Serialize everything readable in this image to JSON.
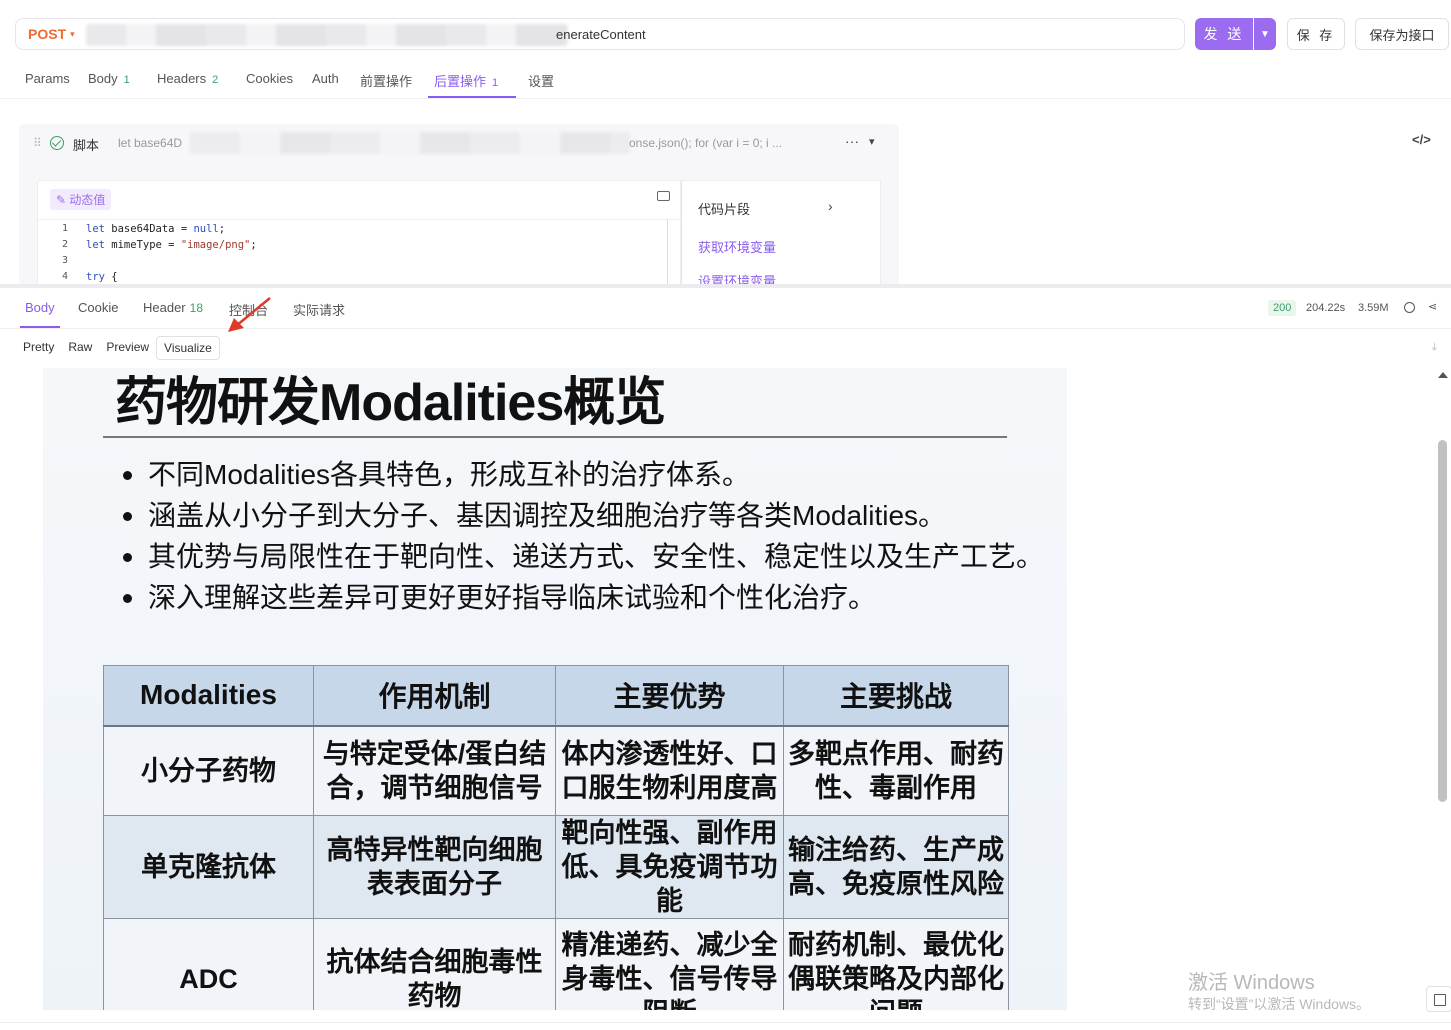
{
  "request": {
    "method": "POST",
    "url_visible": "enerateContent",
    "send_label": "发 送",
    "save_label": "保 存",
    "save_api_label": "保存为接口"
  },
  "req_tabs": [
    {
      "label": "Params",
      "count": ""
    },
    {
      "label": "Body",
      "count": "1"
    },
    {
      "label": "Headers",
      "count": "2"
    },
    {
      "label": "Cookies",
      "count": ""
    },
    {
      "label": "Auth",
      "count": ""
    },
    {
      "label": "前置操作",
      "count": ""
    },
    {
      "label": "后置操作",
      "count": "1",
      "active": true
    },
    {
      "label": "设置",
      "count": ""
    }
  ],
  "script": {
    "title": "脚本",
    "preview_start": "let base64D",
    "preview_end": "onse.json(); for (var i = 0; i ...",
    "dynamic_value": "动态值",
    "lines": [
      {
        "n": "1",
        "text": "let base64Data = null;"
      },
      {
        "n": "2",
        "text": "let mimeType = \"image/png\";"
      },
      {
        "n": "3",
        "text": ""
      },
      {
        "n": "4",
        "text": "try {"
      }
    ],
    "snippets_title": "代码片段",
    "snippets": [
      "获取环境变量",
      "设置环境变量"
    ]
  },
  "response": {
    "tabs": [
      {
        "label": "Body",
        "count": "",
        "active": true
      },
      {
        "label": "Cookie",
        "count": ""
      },
      {
        "label": "Header",
        "count": "18"
      },
      {
        "label": "控制台",
        "count": ""
      },
      {
        "label": "实际请求",
        "count": ""
      }
    ],
    "status": "200",
    "time": "204.22s",
    "size": "3.59M",
    "view_tabs": [
      "Pretty",
      "Raw",
      "Preview",
      "Visualize"
    ],
    "active_view": "Visualize"
  },
  "slide": {
    "title": "药物研发Modalities概览",
    "bullets": [
      "不同Modalities各具特色，形成互补的治疗体系。",
      "涵盖从小分子到大分子、基因调控及细胞治疗等各类Modalities。",
      "其优势与局限性在于靶向性、递送方式、安全性、稳定性以及生产工艺。",
      "深入理解这些差异可更好更好指导临床试验和个性化治疗。"
    ],
    "table": {
      "headers": [
        "Modalities",
        "作用机制",
        "主要优势",
        "主要挑战"
      ],
      "rows": [
        [
          "小分子药物",
          "与特定受体/蛋白结合，调节细胞信号",
          "体内渗透性好、口口服生物利用度高",
          "多靶点作用、耐药性、毒副作用"
        ],
        [
          "单克隆抗体",
          "高特异性靶向细胞表表面分子",
          "靶向性强、副作用低、具免疫调节功能",
          "输注给药、生产成高、免疫原性风险"
        ],
        [
          "ADC",
          "抗体结合细胞毒性药物",
          "精准递药、减少全身毒性、信号传导阻断",
          "耐药机制、最优化偶联策略及内部化问题"
        ]
      ]
    }
  },
  "watermark": {
    "line1": "激活 Windows",
    "line2": "转到“设置”以激活 Windows。"
  },
  "colors": {
    "accent": "#8a5cf0",
    "send_button": "#9c6cf0",
    "method": "#f06a2f",
    "success": "#3aa06a",
    "table_header": "#c7d7ea",
    "annotation_arrow": "#e0392b"
  }
}
